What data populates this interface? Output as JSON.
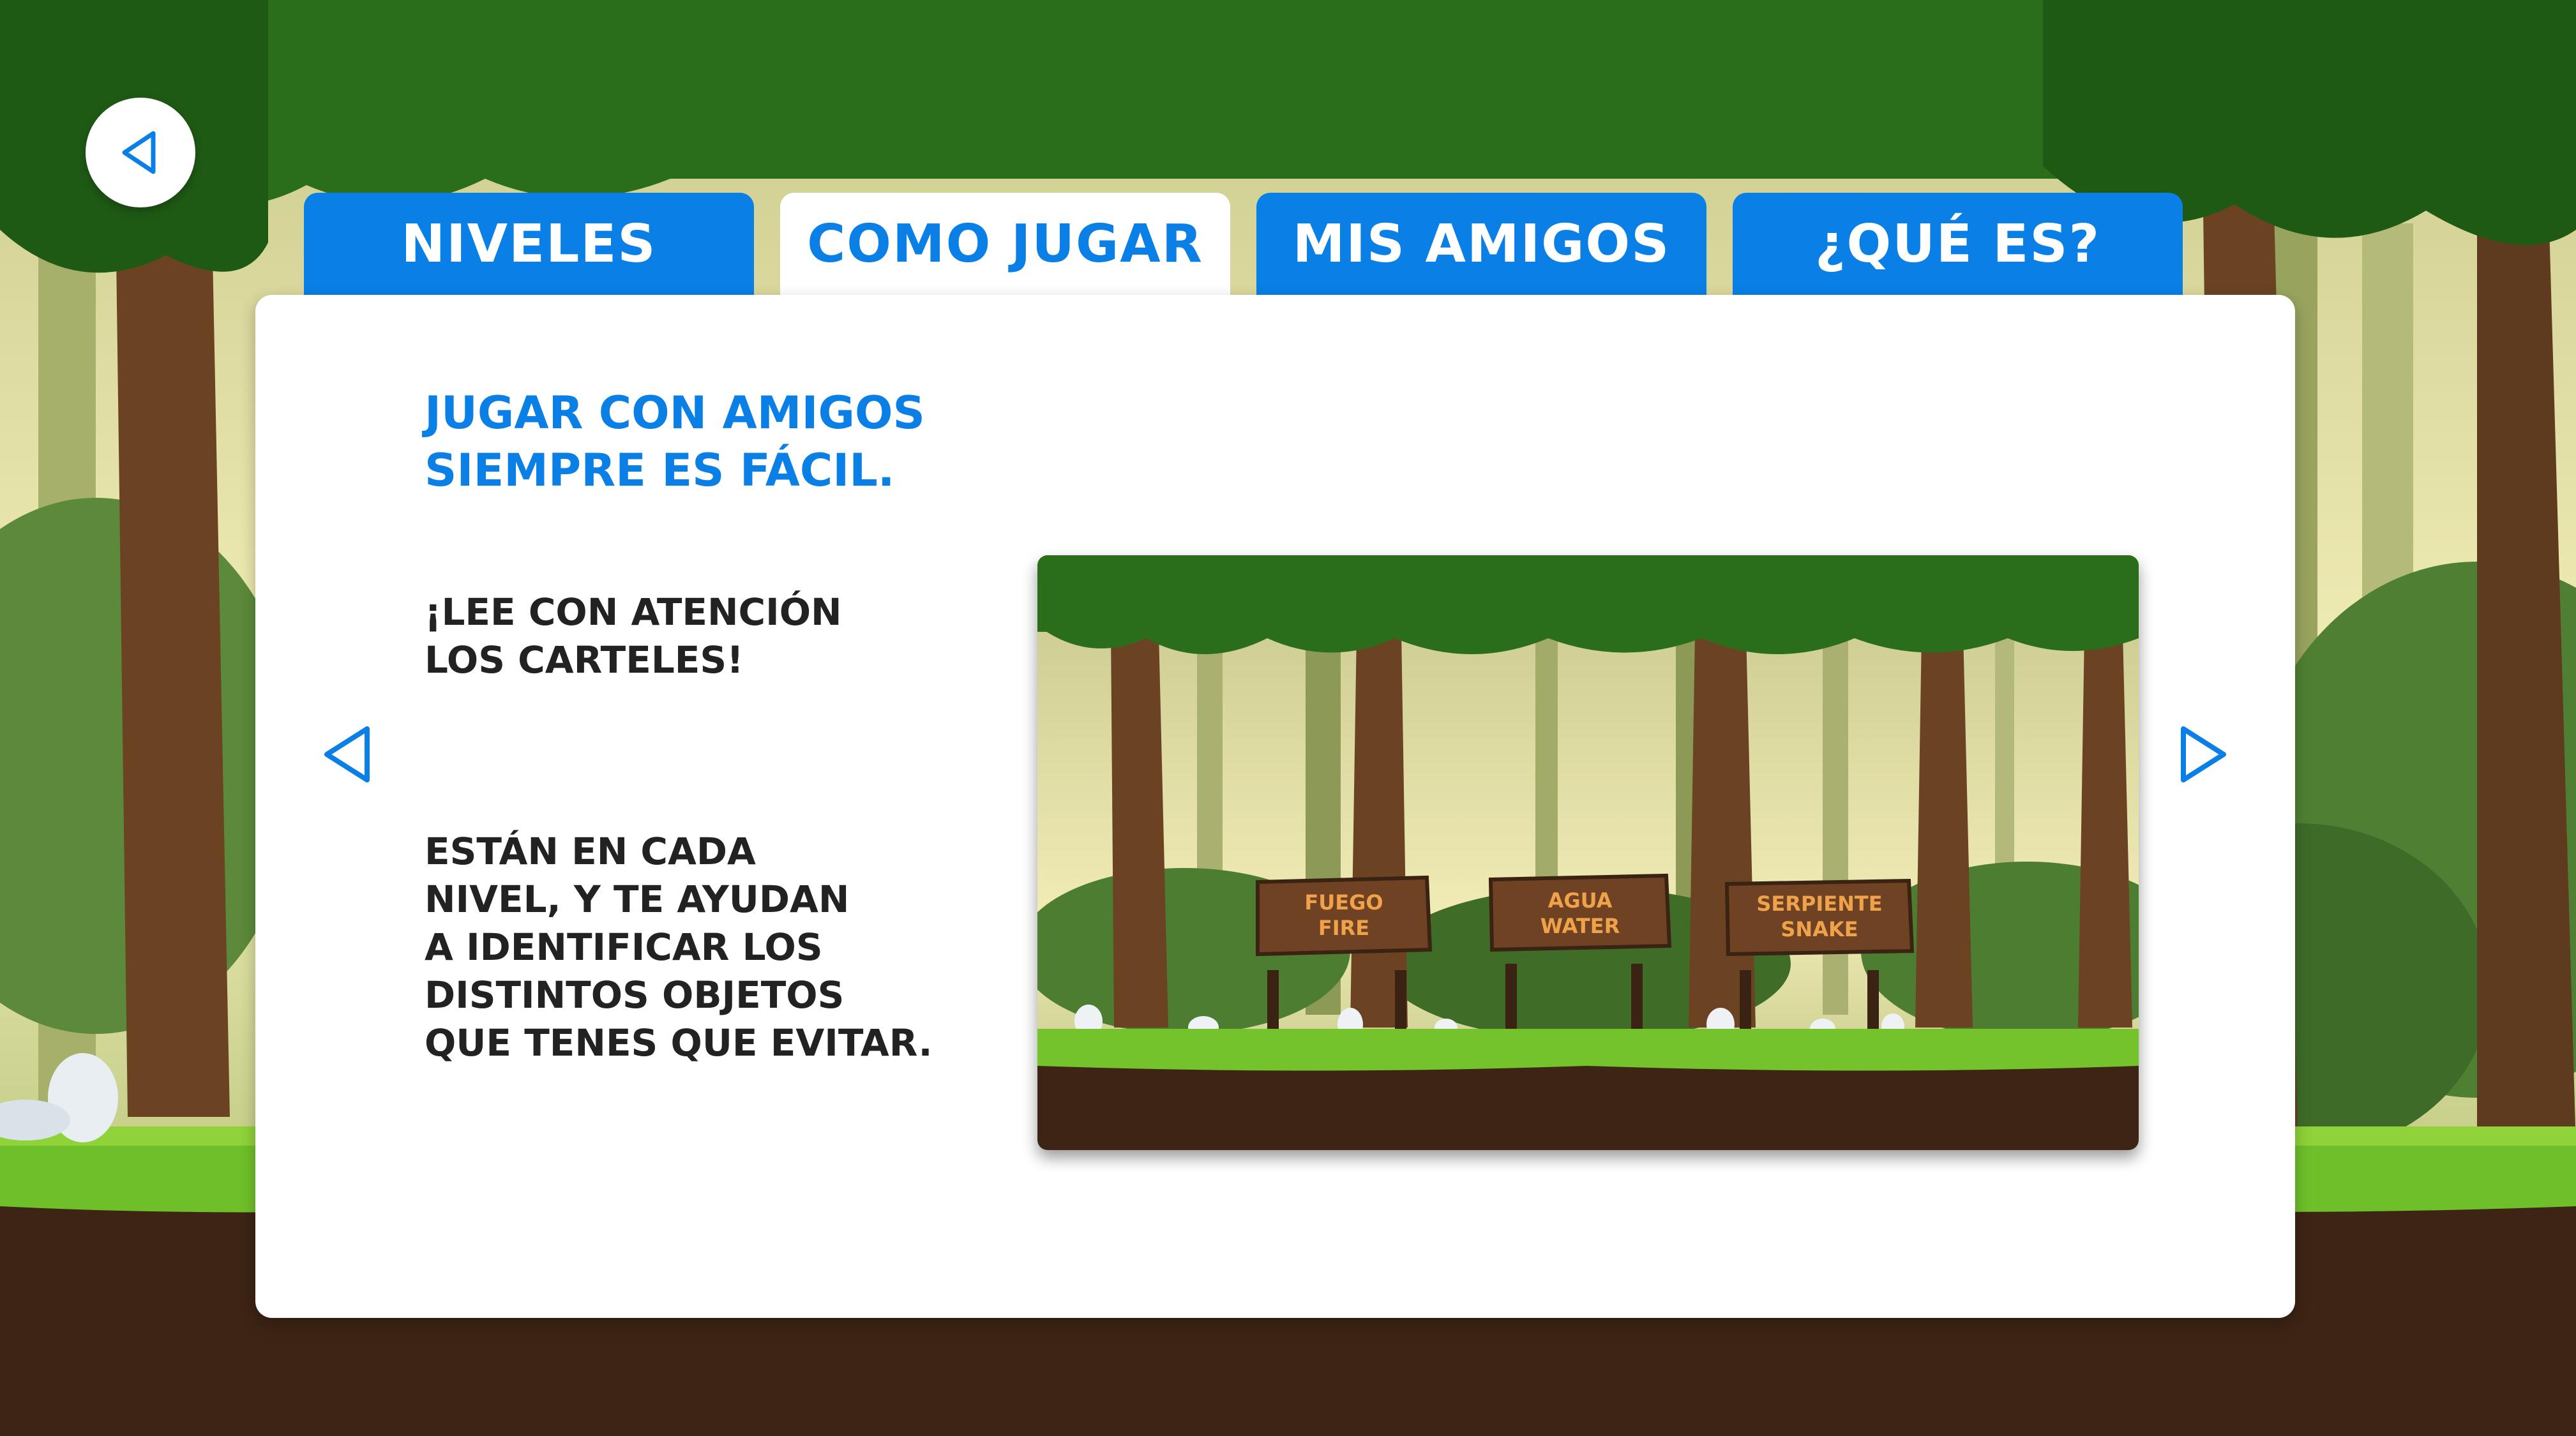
{
  "header": {
    "back_icon": "back-arrow-icon"
  },
  "tabs": [
    {
      "label": "NIVELES",
      "active": false
    },
    {
      "label": "COMO JUGAR",
      "active": true
    },
    {
      "label": "MIS AMIGOS",
      "active": false
    },
    {
      "label": "¿QUÉ ES?",
      "active": false
    }
  ],
  "content": {
    "headline": "JUGAR CON AMIGOS\nSIEMPRE ES FÁCIL.",
    "paragraph1": "¡LEE CON ATENCIÓN\nLOS CARTELES!",
    "paragraph2": "ESTÁN EN CADA\nNIVEL, Y TE AYUDAN\nA IDENTIFICAR LOS\nDISTINTOS OBJETOS\nQUE TENES QUE EVITAR."
  },
  "navigation": {
    "prev_icon": "chevron-left-icon",
    "next_icon": "chevron-right-icon"
  },
  "preview_signs": [
    {
      "line1": "FUEGO",
      "line2": "FIRE"
    },
    {
      "line1": "AGUA",
      "line2": "WATER"
    },
    {
      "line1": "SERPIENTE",
      "line2": "SNAKE"
    }
  ],
  "colors": {
    "accent": "#0a7fe6",
    "text": "#222222",
    "panel": "#ffffff",
    "sign_text": "#f0a24a"
  }
}
